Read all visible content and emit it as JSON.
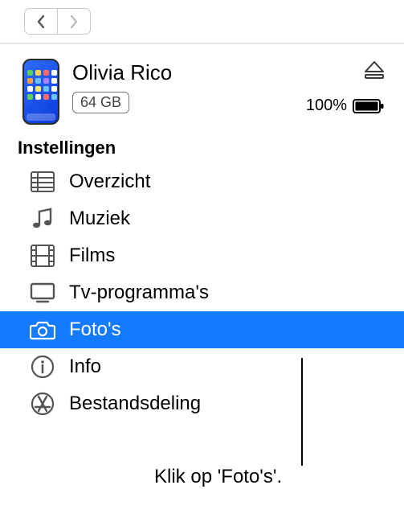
{
  "device": {
    "name": "Olivia Rico",
    "storage": "64 GB",
    "battery_pct": "100%"
  },
  "section_title": "Instellingen",
  "settings": [
    {
      "id": "overview",
      "label": "Overzicht",
      "icon": "list-icon",
      "selected": false
    },
    {
      "id": "music",
      "label": "Muziek",
      "icon": "music-note-icon",
      "selected": false
    },
    {
      "id": "movies",
      "label": "Films",
      "icon": "film-icon",
      "selected": false
    },
    {
      "id": "tv",
      "label": "Tv-programma's",
      "icon": "tv-icon",
      "selected": false
    },
    {
      "id": "photos",
      "label": "Foto's",
      "icon": "camera-icon",
      "selected": true
    },
    {
      "id": "info",
      "label": "Info",
      "icon": "info-icon",
      "selected": false
    },
    {
      "id": "filesharing",
      "label": "Bestandsdeling",
      "icon": "app-store-icon",
      "selected": false
    }
  ],
  "callout": {
    "text": "Klik op 'Foto's'."
  },
  "colors": {
    "selection": "#147aff"
  }
}
